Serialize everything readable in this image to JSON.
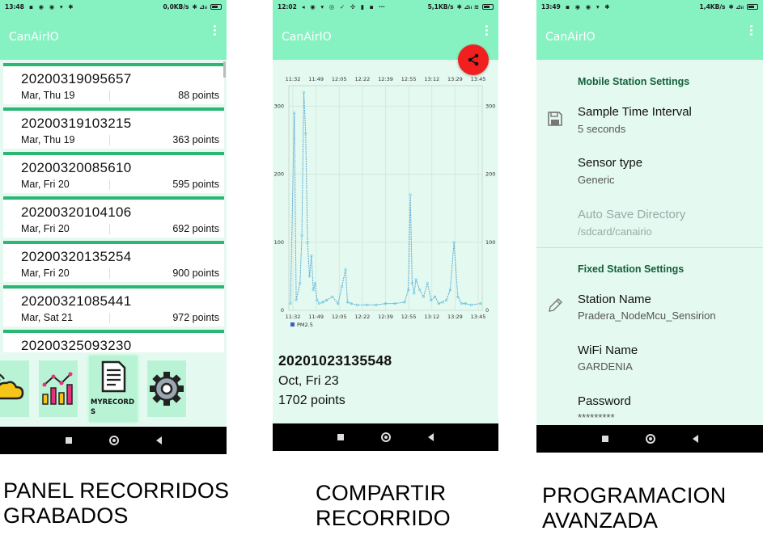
{
  "panel1": {
    "status": {
      "time": "13:48",
      "speed": "0,0KB/s"
    },
    "app_title": "CanAirIO",
    "records": [
      {
        "name": "20200319095657",
        "date": "Mar, Thu 19",
        "points": "88 points"
      },
      {
        "name": "20200319103215",
        "date": "Mar, Thu 19",
        "points": "363 points"
      },
      {
        "name": "20200320085610",
        "date": "Mar, Fri 20",
        "points": "595 points"
      },
      {
        "name": "20200320104106",
        "date": "Mar, Fri 20",
        "points": "692 points"
      },
      {
        "name": "20200320135254",
        "date": "Mar, Fri 20",
        "points": "900 points"
      },
      {
        "name": "20200321085441",
        "date": "Mar, Sat 21",
        "points": "972 points"
      },
      {
        "name": "20200325093230",
        "date": "",
        "points": ""
      }
    ],
    "tiles": {
      "records_label": "MYRECORDS"
    },
    "icons": [
      "cloud-icon",
      "bar-chart-icon",
      "document-icon",
      "gear-icon"
    ],
    "caption_line1": "PANEL RECORRIDOS",
    "caption_line2": "GRABADOS"
  },
  "panel2": {
    "status": {
      "time": "12:02",
      "speed": "5,1KB/s"
    },
    "app_title": "CanAirIO",
    "record_name": "20201023135548",
    "record_date": "Oct, Fri 23",
    "record_points": "1702 points",
    "caption_line1": "COMPARTIR",
    "caption_line2": "RECORRIDO",
    "chart_data": {
      "type": "line",
      "title": "",
      "x_ticks": [
        "11:32",
        "11:49",
        "12:05",
        "12:22",
        "12:39",
        "12:55",
        "13:12",
        "13:29",
        "13:45"
      ],
      "y_ticks": [
        0,
        100,
        200,
        300
      ],
      "ylim": [
        0,
        330
      ],
      "legend": "bottom-left",
      "grid": true,
      "series": [
        {
          "name": "PM2.5",
          "color": "#5aa9d6",
          "x": [
            0,
            0.02,
            0.03,
            0.05,
            0.06,
            0.07,
            0.08,
            0.09,
            0.1,
            0.11,
            0.12,
            0.13,
            0.14,
            0.15,
            0.17,
            0.19,
            0.22,
            0.25,
            0.27,
            0.29,
            0.3,
            0.32,
            0.35,
            0.4,
            0.45,
            0.5,
            0.55,
            0.6,
            0.62,
            0.63,
            0.64,
            0.65,
            0.66,
            0.68,
            0.7,
            0.72,
            0.74,
            0.76,
            0.78,
            0.8,
            0.82,
            0.84,
            0.86,
            0.88,
            0.9,
            0.92,
            0.95,
            1.0
          ],
          "values": [
            10,
            290,
            15,
            40,
            110,
            320,
            260,
            100,
            50,
            80,
            30,
            40,
            15,
            10,
            12,
            15,
            20,
            10,
            35,
            60,
            12,
            10,
            8,
            8,
            8,
            10,
            10,
            12,
            30,
            170,
            40,
            25,
            45,
            30,
            20,
            40,
            15,
            20,
            10,
            12,
            15,
            30,
            100,
            20,
            10,
            10,
            8,
            10
          ]
        }
      ]
    }
  },
  "panel3": {
    "status": {
      "time": "13:49",
      "speed": "1,4KB/s"
    },
    "app_title": "CanAirIO",
    "mobile_header": "Mobile Station Settings",
    "sample_time_title": "Sample Time Interval",
    "sample_time_value": "5 seconds",
    "sensor_type_title": "Sensor type",
    "sensor_type_value": "Generic",
    "autosave_title": "Auto Save Directory",
    "autosave_value": "/sdcard/canairio",
    "fixed_header": "Fixed Station Settings",
    "station_name_title": "Station Name",
    "station_name_value": "Pradera_NodeMcu_Sensirion",
    "wifi_name_title": "WiFi Name",
    "wifi_name_value": "GARDENIA",
    "password_title": "Password",
    "password_value": "*********",
    "caption_line1": "PROGRAMACION",
    "caption_line2": "AVANZADA"
  }
}
